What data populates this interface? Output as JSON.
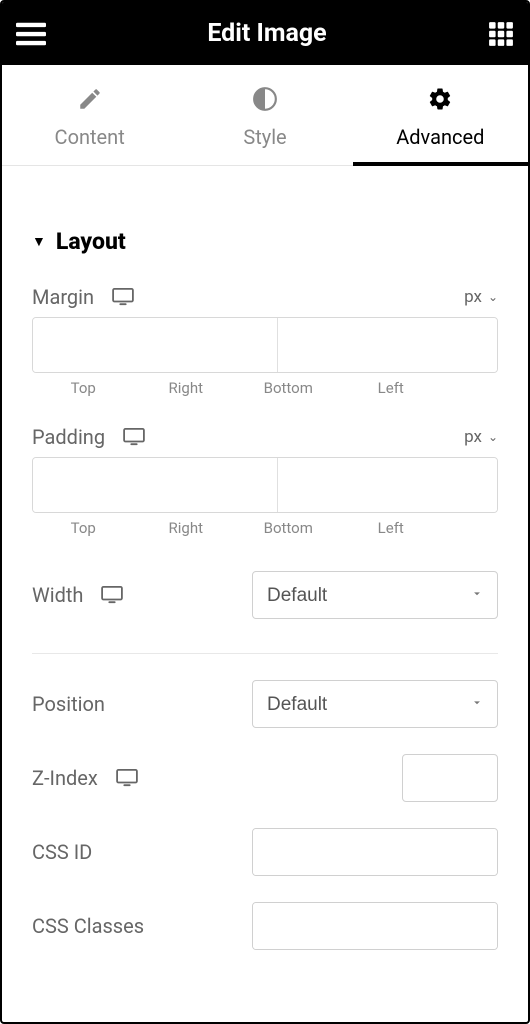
{
  "header": {
    "title": "Edit Image"
  },
  "tabs": [
    {
      "label": "Content"
    },
    {
      "label": "Style"
    },
    {
      "label": "Advanced"
    }
  ],
  "layout": {
    "section_title": "Layout",
    "margin": {
      "label": "Margin",
      "unit": "px",
      "sides": {
        "top": "Top",
        "right": "Right",
        "bottom": "Bottom",
        "left": "Left"
      }
    },
    "padding": {
      "label": "Padding",
      "unit": "px",
      "sides": {
        "top": "Top",
        "right": "Right",
        "bottom": "Bottom",
        "left": "Left"
      }
    },
    "width": {
      "label": "Width",
      "value": "Default"
    },
    "position": {
      "label": "Position",
      "value": "Default"
    },
    "zindex": {
      "label": "Z-Index"
    },
    "cssid": {
      "label": "CSS ID"
    },
    "cssclasses": {
      "label": "CSS Classes"
    }
  }
}
